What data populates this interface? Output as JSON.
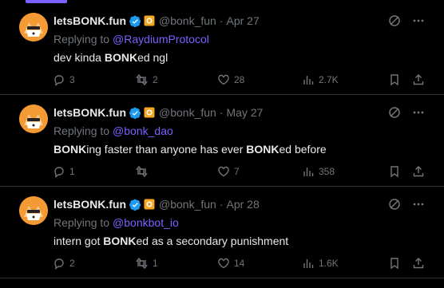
{
  "colors": {
    "accent": "#7b61ff",
    "muted": "#71767b",
    "text": "#e7e9ea",
    "border": "#2f3336",
    "verified": "#1d9bf0",
    "affiliate": "#f5a623"
  },
  "tweets": [
    {
      "name": "letsBONK.fun",
      "handle": "@bonk_fun",
      "date": "Apr 27",
      "replying_prefix": "Replying to",
      "replying_to": "@RaydiumProtocol",
      "text_parts": [
        "dev kinda ",
        "BONK",
        "ed ngl"
      ],
      "replies": "3",
      "reposts": "2",
      "likes": "28",
      "views": "2.7K"
    },
    {
      "name": "letsBONK.fun",
      "handle": "@bonk_fun",
      "date": "May 27",
      "replying_prefix": "Replying to",
      "replying_to": "@bonk_dao",
      "text_parts": [
        "BONK",
        "ing faster than anyone has ever ",
        "BONK",
        "ed before"
      ],
      "replies": "1",
      "reposts": "",
      "likes": "7",
      "views": "358"
    },
    {
      "name": "letsBONK.fun",
      "handle": "@bonk_fun",
      "date": "Apr 28",
      "replying_prefix": "Replying to",
      "replying_to": "@bonkbot_io",
      "text_parts": [
        "intern got ",
        "BONK",
        "ed as a secondary punishment"
      ],
      "replies": "2",
      "reposts": "1",
      "likes": "14",
      "views": "1.6K"
    }
  ]
}
